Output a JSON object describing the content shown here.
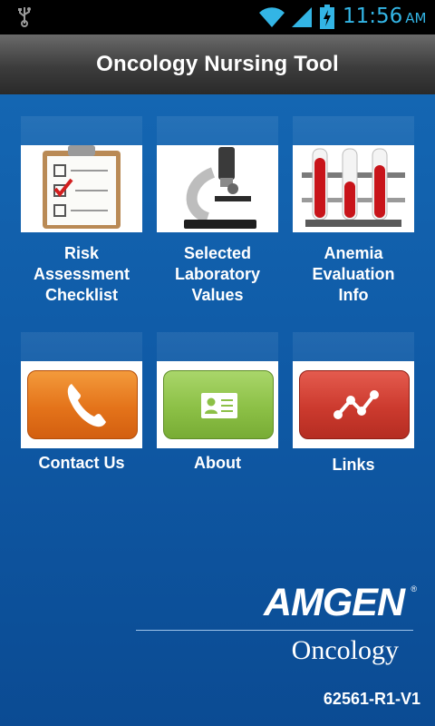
{
  "status_bar": {
    "time": "11:56",
    "ampm": "AM",
    "icons": [
      "usb-icon",
      "wifi-icon",
      "signal-icon",
      "battery-charging-icon"
    ]
  },
  "header": {
    "title": "Oncology Nursing Tool"
  },
  "tiles": [
    {
      "id": "risk",
      "label": "Risk\nAssessment\nChecklist",
      "icon": "clipboard-checklist-icon"
    },
    {
      "id": "lab",
      "label": "Selected\nLaboratory\nValues",
      "icon": "microscope-icon"
    },
    {
      "id": "anemia",
      "label": "Anemia\nEvaluation\nInfo",
      "icon": "test-tubes-icon"
    },
    {
      "id": "contact",
      "label": "Contact Us",
      "icon": "phone-icon",
      "color": "#e4731a"
    },
    {
      "id": "about",
      "label": "About",
      "icon": "id-card-icon",
      "color": "#8cc046"
    },
    {
      "id": "links",
      "label": "Links",
      "icon": "link-graph-icon",
      "color": "#cc3a2e"
    }
  ],
  "footer": {
    "brand": "AMGEN",
    "division": "Oncology",
    "code": "62561-R1-V1"
  },
  "colors": {
    "background": "#0f5aa6",
    "status_time": "#33b5e5"
  }
}
